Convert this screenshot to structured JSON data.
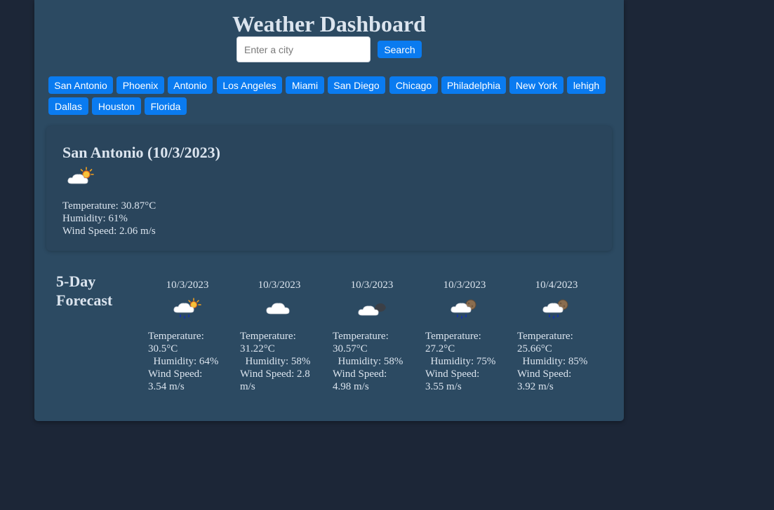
{
  "app": {
    "title": "Weather Dashboard"
  },
  "search": {
    "placeholder": "Enter a city",
    "value": "",
    "button_label": "Search"
  },
  "cities": [
    "San Antonio",
    "Phoenix",
    "Antonio",
    "Los Angeles",
    "Miami",
    "San Diego",
    "Chicago",
    "Philadelphia",
    "New York",
    "lehigh",
    "Dallas",
    "Houston",
    "Florida"
  ],
  "current": {
    "title": "San Antonio (10/3/2023)",
    "icon": "sun-behind-cloud-icon",
    "temperature": "Temperature: 30.87°C",
    "humidity": "Humidity: 61%",
    "wind": "Wind Speed: 2.06 m/s"
  },
  "forecast": {
    "heading": "5-Day Forecast",
    "days": [
      {
        "date": "10/3/2023",
        "icon": "sun-rain-icon",
        "temp_label": "Temperature:",
        "temp": "30.5°C",
        "humidity": "Humidity: 64%",
        "wind_label": "Wind Speed:",
        "wind": "3.54 m/s"
      },
      {
        "date": "10/3/2023",
        "icon": "cloud-icon",
        "temp_label": "Temperature:",
        "temp": "31.22°C",
        "humidity": "Humidity: 58%",
        "wind_label": "Wind Speed: 2.8",
        "wind": "m/s"
      },
      {
        "date": "10/3/2023",
        "icon": "moon-behind-cloud-icon",
        "temp_label": "Temperature:",
        "temp": "30.57°C",
        "humidity": "Humidity: 58%",
        "wind_label": "Wind Speed:",
        "wind": "4.98 m/s"
      },
      {
        "date": "10/3/2023",
        "icon": "night-rain-icon",
        "temp_label": "Temperature:",
        "temp": "27.2°C",
        "humidity": "Humidity: 75%",
        "wind_label": "Wind Speed:",
        "wind": "3.55 m/s"
      },
      {
        "date": "10/4/2023",
        "icon": "night-rain-icon",
        "temp_label": "Temperature:",
        "temp": "25.66°C",
        "humidity": "Humidity: 85%",
        "wind_label": "Wind Speed:",
        "wind": "3.92 m/s"
      }
    ]
  },
  "colors": {
    "page_bg": "#1c2637",
    "panel_bg": "#2c4a62",
    "accent": "#0a7bf0",
    "text": "#dbe4ee"
  }
}
